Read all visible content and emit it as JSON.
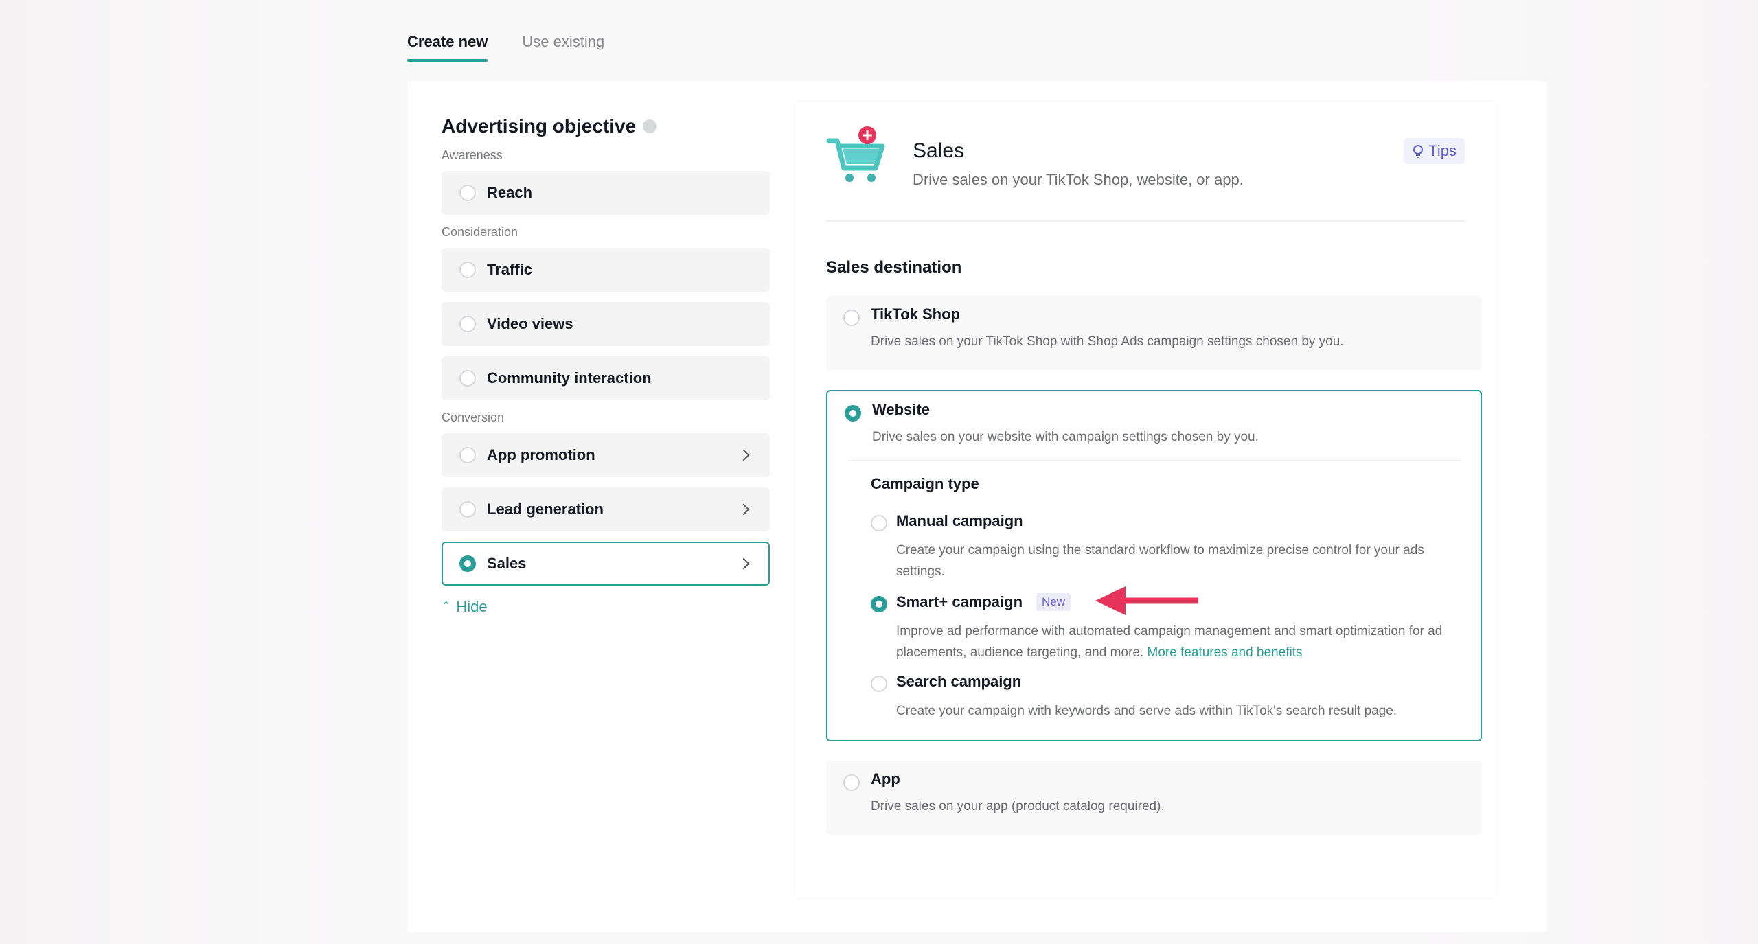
{
  "tabs": [
    {
      "label": "Create new",
      "active": true
    },
    {
      "label": "Use existing",
      "active": false
    }
  ],
  "objective": {
    "title": "Advertising objective",
    "groups": {
      "awareness": "Awareness",
      "consideration": "Consideration",
      "conversion": "Conversion"
    },
    "options": {
      "reach": "Reach",
      "traffic": "Traffic",
      "video_views": "Video views",
      "community_interaction": "Community interaction",
      "app_promotion": "App promotion",
      "lead_generation": "Lead generation",
      "sales": "Sales"
    },
    "selected": "Sales",
    "hide_label": "Hide"
  },
  "sales_panel": {
    "title": "Sales",
    "subtitle": "Drive sales on your TikTok Shop, website, or app.",
    "tips_label": "Tips",
    "destination_title": "Sales destination",
    "destinations": {
      "tiktok_shop": {
        "label": "TikTok Shop",
        "desc": "Drive sales on your TikTok Shop with Shop Ads campaign settings chosen by you."
      },
      "website": {
        "label": "Website",
        "desc": "Drive sales on your website with campaign settings chosen by you."
      },
      "app": {
        "label": "App",
        "desc": "Drive sales on your app (product catalog required)."
      }
    },
    "selected_destination": "Website",
    "campaign_type_title": "Campaign type",
    "campaigns": {
      "manual": {
        "label": "Manual campaign",
        "desc": "Create your campaign using the standard workflow to maximize precise control for your ads settings."
      },
      "smart": {
        "label": "Smart+ campaign",
        "badge": "New",
        "desc": "Improve ad performance with automated campaign management and smart optimization for ad placements, audience targeting, and more.",
        "link": "More features and benefits"
      },
      "search": {
        "label": "Search campaign",
        "desc": "Create your campaign with keywords and serve ads within TikTok's search result page."
      }
    },
    "selected_campaign": "Smart+ campaign"
  },
  "colors": {
    "accent": "#2a9d98",
    "badge": "#6b5fd0",
    "annotation_arrow": "#e5335a"
  }
}
